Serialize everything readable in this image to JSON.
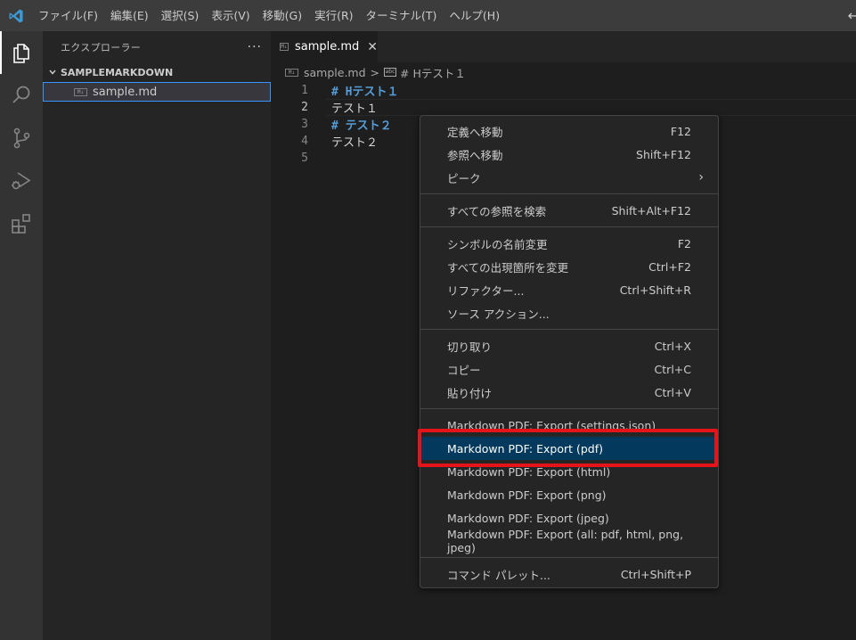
{
  "menubar": {
    "items": [
      "ファイル(F)",
      "編集(E)",
      "選択(S)",
      "表示(V)",
      "移動(G)",
      "実行(R)",
      "ターミナル(T)",
      "ヘルプ(H)"
    ],
    "back_glyph": "←"
  },
  "activity_bar": {
    "icons": [
      "explorer-icon",
      "search-icon",
      "source-control-icon",
      "run-debug-icon",
      "extensions-icon"
    ]
  },
  "sidebar": {
    "title": "エクスプローラー",
    "more": "···",
    "section": "SAMPLEMARKDOWN",
    "file": "sample.md",
    "file_badge": "M↓"
  },
  "editor": {
    "tab_label": "sample.md",
    "tab_close": "✕",
    "breadcrumb": {
      "file": "sample.md",
      "sep": ">",
      "symbol": "# Hテスト１"
    },
    "lines": [
      {
        "num": "1",
        "text": "# Hテスト１"
      },
      {
        "num": "2",
        "text": "テスト１"
      },
      {
        "num": "3",
        "text": "# テスト２"
      },
      {
        "num": "4",
        "text": "テスト２"
      },
      {
        "num": "5",
        "text": ""
      }
    ],
    "current_line": 2
  },
  "context_menu": {
    "groups": [
      [
        {
          "label": "定義へ移動",
          "shortcut": "F12"
        },
        {
          "label": "参照へ移動",
          "shortcut": "Shift+F12"
        },
        {
          "label": "ピーク",
          "shortcut": "›"
        }
      ],
      [
        {
          "label": "すべての参照を検索",
          "shortcut": "Shift+Alt+F12"
        }
      ],
      [
        {
          "label": "シンボルの名前変更",
          "shortcut": "F2"
        },
        {
          "label": "すべての出現箇所を変更",
          "shortcut": "Ctrl+F2"
        },
        {
          "label": "リファクター...",
          "shortcut": "Ctrl+Shift+R"
        },
        {
          "label": "ソース アクション...",
          "shortcut": ""
        }
      ],
      [
        {
          "label": "切り取り",
          "shortcut": "Ctrl+X"
        },
        {
          "label": "コピー",
          "shortcut": "Ctrl+C"
        },
        {
          "label": "貼り付け",
          "shortcut": "Ctrl+V"
        }
      ],
      [
        {
          "label": "Markdown PDF: Export (settings.json)",
          "shortcut": ""
        },
        {
          "label": "Markdown PDF: Export (pdf)",
          "shortcut": ""
        },
        {
          "label": "Markdown PDF: Export (html)",
          "shortcut": ""
        },
        {
          "label": "Markdown PDF: Export (png)",
          "shortcut": ""
        },
        {
          "label": "Markdown PDF: Export (jpeg)",
          "shortcut": ""
        },
        {
          "label": "Markdown PDF: Export (all: pdf, html, png, jpeg)",
          "shortcut": ""
        }
      ],
      [
        {
          "label": "コマンド パレット...",
          "shortcut": "Ctrl+Shift+P"
        }
      ]
    ],
    "highlighted_label": "Markdown PDF: Export (pdf)"
  },
  "colors": {
    "accent": "#0078d4",
    "highlight_bg": "#04395e",
    "annotation_red": "#e5141b",
    "heading_blue": "#569cd6"
  }
}
